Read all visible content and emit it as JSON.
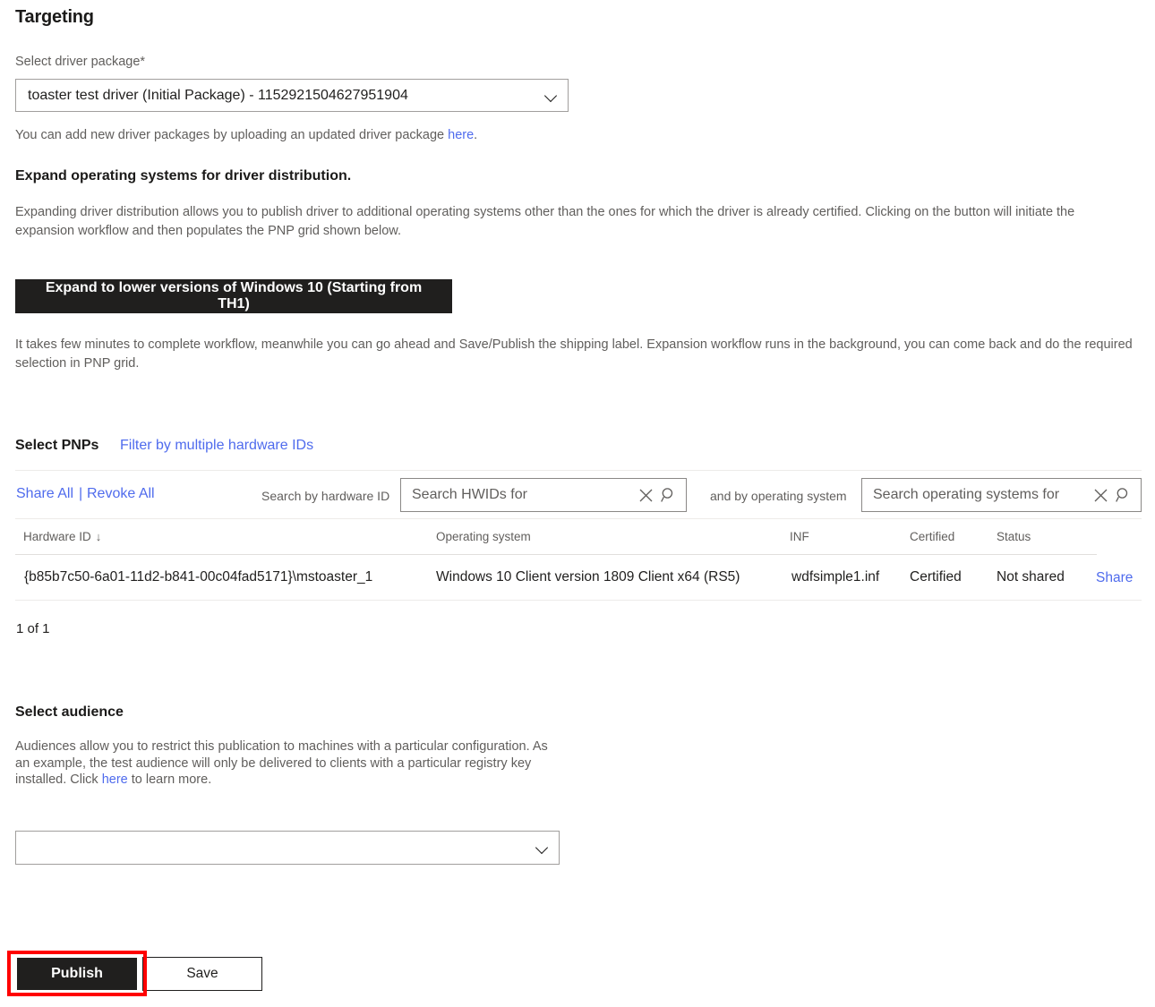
{
  "page": {
    "title": "Targeting"
  },
  "driver_package": {
    "label": "Select driver package*",
    "selected": "toaster test driver (Initial Package) - 1152921504627951904",
    "help_prefix": "You can add new driver packages by uploading an updated driver package ",
    "help_link": "here",
    "help_suffix": "."
  },
  "expand": {
    "heading": "Expand operating systems for driver distribution.",
    "description": "Expanding driver distribution allows you to publish driver to additional operating systems other than the ones for which the driver is already certified. Clicking on the button will initiate the expansion workflow and then populates the PNP grid shown below.",
    "button_label": "Expand to lower versions of Windows 10 (Starting from TH1)",
    "note": "It takes few minutes to complete workflow, meanwhile you can go ahead and Save/Publish the shipping label. Expansion workflow runs in the background, you can come back and do the required selection in PNP grid."
  },
  "pnp": {
    "heading": "Select PNPs",
    "filter_link": "Filter by multiple hardware IDs",
    "share_all": "Share All",
    "separator": "|",
    "revoke_all": "Revoke All",
    "search_hwid_label": "Search by hardware ID",
    "search_hwid_placeholder": "Search HWIDs for",
    "search_os_label": "and by operating system",
    "search_os_placeholder": "Search operating systems for",
    "columns": [
      "Hardware ID",
      "Operating system",
      "INF",
      "Certified",
      "Status",
      ""
    ],
    "sort_column": "Hardware ID",
    "sort_direction": "desc",
    "rows": [
      {
        "hardware_id": "{b85b7c50-6a01-11d2-b841-00c04fad5171}\\mstoaster_1",
        "operating_system": "Windows 10 Client version 1809 Client x64 (RS5)",
        "inf": "wdfsimple1.inf",
        "certified": "Certified",
        "status": "Not shared",
        "action": "Share"
      }
    ],
    "count_text": "1 of 1"
  },
  "audience": {
    "heading": "Select audience",
    "description_part1": "Audiences allow you to restrict this publication to machines with a particular configuration. As an example, the test audience will only be delivered to clients with a particular registry key installed. Click ",
    "description_link": "here",
    "description_part2": " to learn more.",
    "selected": ""
  },
  "footer": {
    "publish_label": "Publish",
    "save_label": "Save"
  },
  "colors": {
    "link": "#4f6bed",
    "dark": "#201f1e",
    "highlight": "#ff0000",
    "muted": "#605e5c"
  }
}
